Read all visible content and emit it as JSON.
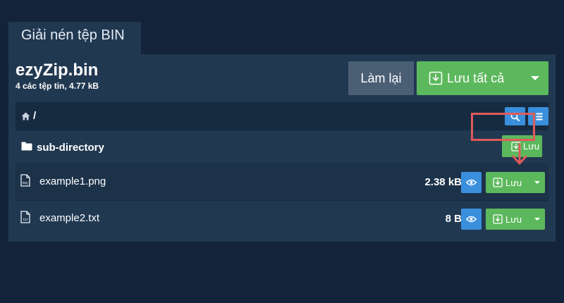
{
  "tab": {
    "label": "Giải nén tệp BIN"
  },
  "archive": {
    "title": "ezyZip.bin",
    "subtitle": "4 các tệp tin, 4.77 kB"
  },
  "actions": {
    "reset_label": "Làm lại",
    "save_all_label": "Lưu tất cả"
  },
  "path": {
    "text": "/"
  },
  "rows": [
    {
      "type": "directory",
      "name": "sub-directory",
      "save_label": "Lưu"
    },
    {
      "type": "file",
      "name": "example1.png",
      "size": "2.38 kB",
      "icon_tag": "PNG",
      "save_label": "Lưu"
    },
    {
      "type": "file",
      "name": "example2.txt",
      "size": "8 B",
      "icon_tag": "TXT",
      "save_label": "Lưu"
    }
  ],
  "colors": {
    "page_bg": "#13243a",
    "panel_bg": "#213851",
    "accent_green": "#5cb85c",
    "accent_blue": "#3a8fdc",
    "highlight_red": "#e05a5a",
    "reset_gray": "#4b5f74"
  },
  "icons": [
    "home-icon",
    "search-icon",
    "list-icon",
    "folder-icon",
    "file-icon",
    "eye-icon",
    "download-icon",
    "caret-down-icon",
    "arrow-down-icon"
  ]
}
